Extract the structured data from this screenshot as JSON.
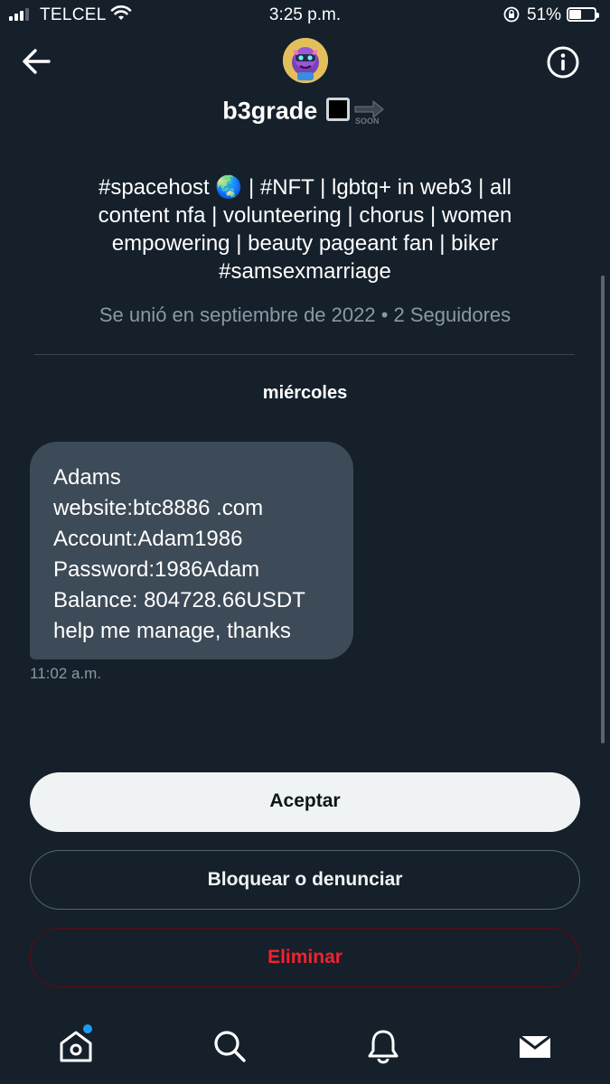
{
  "status_bar": {
    "carrier": "TELCEL",
    "time": "3:25 p.m.",
    "battery": "51%",
    "battery_level": 0.51
  },
  "header": {
    "back_icon": "arrow-left-icon",
    "info_icon": "info-icon",
    "name": "b3grade",
    "name_emoji": "⬛➡️🔜"
  },
  "profile": {
    "bio_lines": [
      "#spacehost 🌏 | #NFT | lgbtq+ in web3 | all",
      "content nfa | volunteering | chorus | women",
      "empowering | beauty pageant fan | biker",
      "#samsexmarriage"
    ],
    "joined": "Se unió en septiembre de 2022 • 2 Seguidores"
  },
  "conversation": {
    "day_label": "miércoles",
    "message": {
      "lines": [
        "Adams",
        "website:btc8886 .com",
        "Account:Adam1986",
        "Password:1986Adam",
        "Balance: 804728.66USDT",
        "help me manage, thanks"
      ],
      "time": "11:02 a.m."
    }
  },
  "actions": {
    "accept": "Aceptar",
    "block": "Bloquear o denunciar",
    "delete": "Eliminar"
  },
  "tabbar": {
    "tabs": [
      "home-icon",
      "search-icon",
      "bell-icon",
      "mail-icon"
    ]
  },
  "colors": {
    "background": "#15202b",
    "bubble": "#3d4a57",
    "muted": "#8b98a5",
    "danger": "#f4212e",
    "notification_dot": "#1d9bf0"
  }
}
